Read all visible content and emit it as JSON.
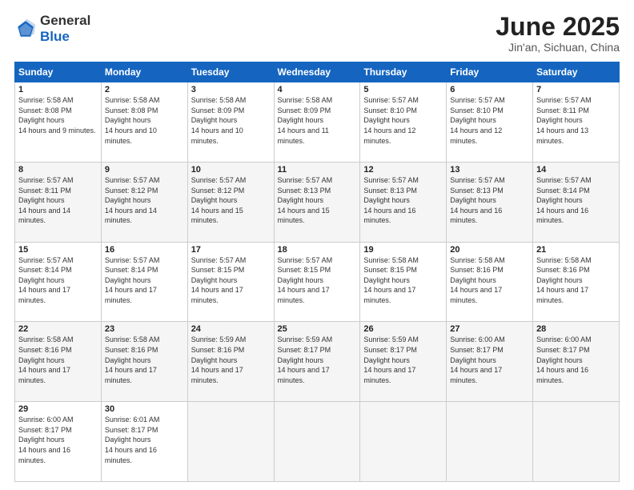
{
  "header": {
    "logo_general": "General",
    "logo_blue": "Blue",
    "month_title": "June 2025",
    "location": "Jin'an, Sichuan, China"
  },
  "weekdays": [
    "Sunday",
    "Monday",
    "Tuesday",
    "Wednesday",
    "Thursday",
    "Friday",
    "Saturday"
  ],
  "weeks": [
    [
      {
        "day": "1",
        "sunrise": "5:58 AM",
        "sunset": "8:08 PM",
        "daylight": "14 hours and 9 minutes."
      },
      {
        "day": "2",
        "sunrise": "5:58 AM",
        "sunset": "8:08 PM",
        "daylight": "14 hours and 10 minutes."
      },
      {
        "day": "3",
        "sunrise": "5:58 AM",
        "sunset": "8:09 PM",
        "daylight": "14 hours and 10 minutes."
      },
      {
        "day": "4",
        "sunrise": "5:58 AM",
        "sunset": "8:09 PM",
        "daylight": "14 hours and 11 minutes."
      },
      {
        "day": "5",
        "sunrise": "5:57 AM",
        "sunset": "8:10 PM",
        "daylight": "14 hours and 12 minutes."
      },
      {
        "day": "6",
        "sunrise": "5:57 AM",
        "sunset": "8:10 PM",
        "daylight": "14 hours and 12 minutes."
      },
      {
        "day": "7",
        "sunrise": "5:57 AM",
        "sunset": "8:11 PM",
        "daylight": "14 hours and 13 minutes."
      }
    ],
    [
      {
        "day": "8",
        "sunrise": "5:57 AM",
        "sunset": "8:11 PM",
        "daylight": "14 hours and 14 minutes."
      },
      {
        "day": "9",
        "sunrise": "5:57 AM",
        "sunset": "8:12 PM",
        "daylight": "14 hours and 14 minutes."
      },
      {
        "day": "10",
        "sunrise": "5:57 AM",
        "sunset": "8:12 PM",
        "daylight": "14 hours and 15 minutes."
      },
      {
        "day": "11",
        "sunrise": "5:57 AM",
        "sunset": "8:13 PM",
        "daylight": "14 hours and 15 minutes."
      },
      {
        "day": "12",
        "sunrise": "5:57 AM",
        "sunset": "8:13 PM",
        "daylight": "14 hours and 16 minutes."
      },
      {
        "day": "13",
        "sunrise": "5:57 AM",
        "sunset": "8:13 PM",
        "daylight": "14 hours and 16 minutes."
      },
      {
        "day": "14",
        "sunrise": "5:57 AM",
        "sunset": "8:14 PM",
        "daylight": "14 hours and 16 minutes."
      }
    ],
    [
      {
        "day": "15",
        "sunrise": "5:57 AM",
        "sunset": "8:14 PM",
        "daylight": "14 hours and 17 minutes."
      },
      {
        "day": "16",
        "sunrise": "5:57 AM",
        "sunset": "8:14 PM",
        "daylight": "14 hours and 17 minutes."
      },
      {
        "day": "17",
        "sunrise": "5:57 AM",
        "sunset": "8:15 PM",
        "daylight": "14 hours and 17 minutes."
      },
      {
        "day": "18",
        "sunrise": "5:57 AM",
        "sunset": "8:15 PM",
        "daylight": "14 hours and 17 minutes."
      },
      {
        "day": "19",
        "sunrise": "5:58 AM",
        "sunset": "8:15 PM",
        "daylight": "14 hours and 17 minutes."
      },
      {
        "day": "20",
        "sunrise": "5:58 AM",
        "sunset": "8:16 PM",
        "daylight": "14 hours and 17 minutes."
      },
      {
        "day": "21",
        "sunrise": "5:58 AM",
        "sunset": "8:16 PM",
        "daylight": "14 hours and 17 minutes."
      }
    ],
    [
      {
        "day": "22",
        "sunrise": "5:58 AM",
        "sunset": "8:16 PM",
        "daylight": "14 hours and 17 minutes."
      },
      {
        "day": "23",
        "sunrise": "5:58 AM",
        "sunset": "8:16 PM",
        "daylight": "14 hours and 17 minutes."
      },
      {
        "day": "24",
        "sunrise": "5:59 AM",
        "sunset": "8:16 PM",
        "daylight": "14 hours and 17 minutes."
      },
      {
        "day": "25",
        "sunrise": "5:59 AM",
        "sunset": "8:17 PM",
        "daylight": "14 hours and 17 minutes."
      },
      {
        "day": "26",
        "sunrise": "5:59 AM",
        "sunset": "8:17 PM",
        "daylight": "14 hours and 17 minutes."
      },
      {
        "day": "27",
        "sunrise": "6:00 AM",
        "sunset": "8:17 PM",
        "daylight": "14 hours and 17 minutes."
      },
      {
        "day": "28",
        "sunrise": "6:00 AM",
        "sunset": "8:17 PM",
        "daylight": "14 hours and 16 minutes."
      }
    ],
    [
      {
        "day": "29",
        "sunrise": "6:00 AM",
        "sunset": "8:17 PM",
        "daylight": "14 hours and 16 minutes."
      },
      {
        "day": "30",
        "sunrise": "6:01 AM",
        "sunset": "8:17 PM",
        "daylight": "14 hours and 16 minutes."
      },
      null,
      null,
      null,
      null,
      null
    ]
  ]
}
